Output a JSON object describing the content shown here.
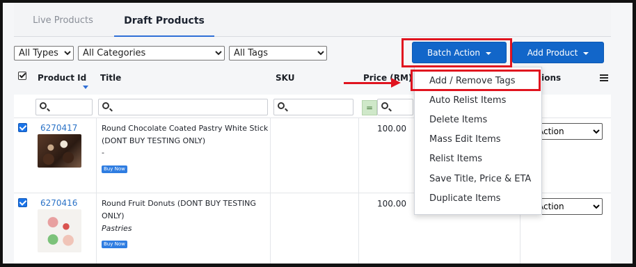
{
  "tabs": [
    {
      "label": "Live Products"
    },
    {
      "label": "Draft Products"
    }
  ],
  "filters": {
    "types": "All Types",
    "categories": "All Categories",
    "tags": "All Tags"
  },
  "buttons": {
    "batch_action": "Batch Action",
    "add_product": "Add Product"
  },
  "table": {
    "headers": {
      "product_id": "Product Id",
      "title": "Title",
      "sku": "SKU",
      "price": "Price (RM)",
      "actions": "Actions"
    },
    "equals_symbol": "=",
    "rows": [
      {
        "id": "6270417",
        "title_line1": "Round Chocolate Coated Pastry White Stick",
        "title_line2": "(DONT BUY TESTING ONLY)",
        "category": "-",
        "badge": "Buy Now",
        "price": "100.00",
        "action": "Action"
      },
      {
        "id": "6270416",
        "title_line1": "Round Fruit Donuts (DONT BUY TESTING",
        "title_line2": "ONLY)",
        "category": "Pastries",
        "badge": "Buy Now",
        "price": "100.00",
        "action": "Action"
      }
    ]
  },
  "batch_menu": [
    {
      "label": "Add / Remove Tags"
    },
    {
      "label": "Auto Relist Items"
    },
    {
      "label": "Delete Items"
    },
    {
      "label": "Mass Edit Items"
    },
    {
      "label": "Relist Items"
    },
    {
      "label": "Save Title, Price & ETA"
    },
    {
      "label": "Duplicate Items"
    }
  ],
  "colors": {
    "accent": "#1266c9",
    "highlight": "#e0141f",
    "link": "#2a72c7"
  }
}
